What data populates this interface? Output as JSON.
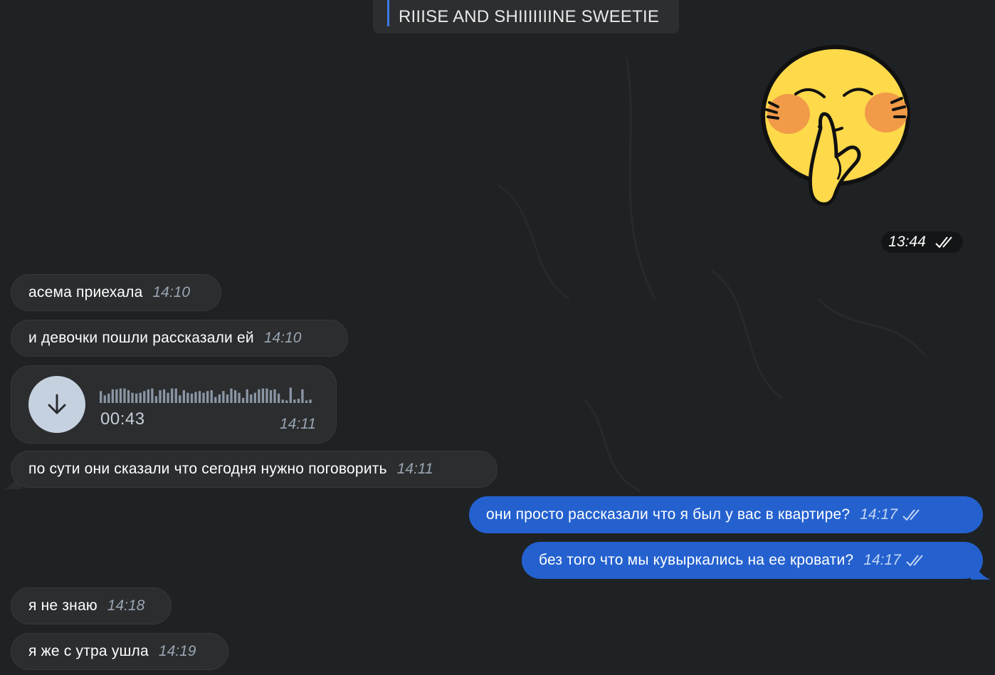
{
  "pinned": {
    "text": "RIIISE AND SHIIIIIIINE SWEETIE"
  },
  "sticker": {
    "time": "13:44"
  },
  "messages": [
    {
      "text": "асема приехала",
      "time": "14:10"
    },
    {
      "text": "и девочки пошли рассказали ей",
      "time": "14:10"
    },
    {
      "text": "по сути они сказали что сегодня нужно поговорить",
      "time": "14:11"
    },
    {
      "text": "они просто рассказали что я был у вас в квартире?",
      "time": "14:17"
    },
    {
      "text": "без того что мы кувыркались на ее кровати?",
      "time": "14:17"
    },
    {
      "text": "я не знаю",
      "time": "14:18"
    },
    {
      "text": "я же с утра ушла",
      "time": "14:19"
    }
  ],
  "voice": {
    "duration": "00:43",
    "time": "14:11",
    "waveform": [
      0.7,
      0.45,
      0.55,
      0.8,
      0.8,
      0.85,
      0.85,
      0.75,
      0.6,
      0.55,
      0.6,
      0.7,
      0.8,
      0.85,
      0.4,
      0.75,
      0.8,
      0.6,
      0.85,
      0.85,
      0.45,
      0.75,
      0.6,
      0.55,
      0.65,
      0.7,
      0.6,
      0.7,
      0.75,
      0.35,
      0.5,
      0.7,
      0.5,
      0.85,
      0.75,
      0.6,
      0.3,
      0.8,
      0.5,
      0.6,
      0.8,
      0.85,
      0.85,
      0.75,
      0.8,
      0.55,
      0.2,
      0.15,
      0.9,
      0.2,
      0.25,
      0.8,
      0.15,
      0.2
    ]
  },
  "colors": {
    "background": "#1f2224",
    "incoming": "#2b2d2f",
    "outgoing": "#2461cf",
    "accent": "#3e7be6"
  }
}
